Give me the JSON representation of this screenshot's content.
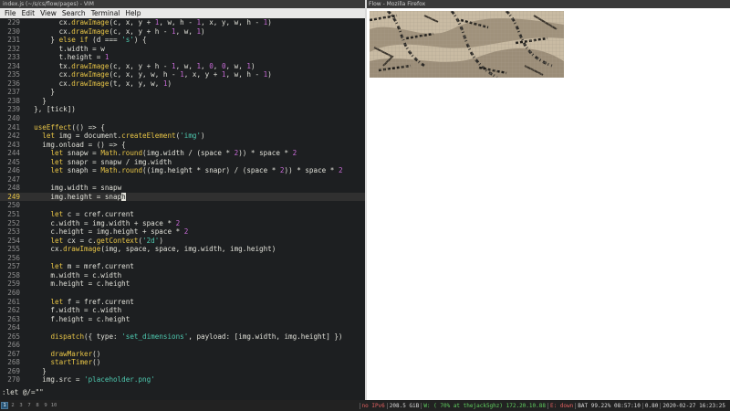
{
  "vim": {
    "window_title": "index.js (~/s/cs/flow/pages) - VIM",
    "menu": [
      "File",
      "Edit",
      "View",
      "Search",
      "Terminal",
      "Help"
    ],
    "command_line": ":let @/=\"\"",
    "current_line": 249,
    "lines": [
      {
        "n": "229",
        "t": "        cx.drawImage(c, x, y + 1, w, h - 1, x, y, w, h - 1)"
      },
      {
        "n": "230",
        "t": "        cx.drawImage(c, x, y + h - 1, w, 1)"
      },
      {
        "n": "231",
        "t": "      } else if (d === 's') {"
      },
      {
        "n": "232",
        "t": "        t.width = w"
      },
      {
        "n": "233",
        "t": "        t.height = 1"
      },
      {
        "n": "234",
        "t": "        tx.drawImage(c, x, y + h - 1, w, 1, 0, 0, w, 1)"
      },
      {
        "n": "235",
        "t": "        cx.drawImage(c, x, y, w, h - 1, x, y + 1, w, h - 1)"
      },
      {
        "n": "236",
        "t": "        cx.drawImage(t, x, y, w, 1)"
      },
      {
        "n": "237",
        "t": "      }"
      },
      {
        "n": "238",
        "t": "    }"
      },
      {
        "n": "239",
        "t": "  }, [tick])"
      },
      {
        "n": "240",
        "t": ""
      },
      {
        "n": "241",
        "t": "  useEffect(() => {"
      },
      {
        "n": "242",
        "t": "    let img = document.createElement('img')"
      },
      {
        "n": "243",
        "t": "    img.onload = () => {"
      },
      {
        "n": "244",
        "t": "      let snapw = Math.round(img.width / (space * 2)) * space * 2"
      },
      {
        "n": "245",
        "t": "      let snapr = snapw / img.width"
      },
      {
        "n": "246",
        "t": "      let snaph = Math.round((img.height * snapr) / (space * 2)) * space * 2"
      },
      {
        "n": "247",
        "t": ""
      },
      {
        "n": "248",
        "t": "      img.width = snapw"
      },
      {
        "n": "249",
        "t": "      img.height = snaph"
      },
      {
        "n": "250",
        "t": ""
      },
      {
        "n": "251",
        "t": "      let c = cref.current"
      },
      {
        "n": "252",
        "t": "      c.width = img.width + space * 2"
      },
      {
        "n": "253",
        "t": "      c.height = img.height + space * 2"
      },
      {
        "n": "254",
        "t": "      let cx = c.getContext('2d')"
      },
      {
        "n": "255",
        "t": "      cx.drawImage(img, space, space, img.width, img.height)"
      },
      {
        "n": "256",
        "t": ""
      },
      {
        "n": "257",
        "t": "      let m = mref.current"
      },
      {
        "n": "258",
        "t": "      m.width = c.width"
      },
      {
        "n": "259",
        "t": "      m.height = c.height"
      },
      {
        "n": "260",
        "t": ""
      },
      {
        "n": "261",
        "t": "      let f = fref.current"
      },
      {
        "n": "262",
        "t": "      f.width = c.width"
      },
      {
        "n": "263",
        "t": "      f.height = c.height"
      },
      {
        "n": "264",
        "t": ""
      },
      {
        "n": "265",
        "t": "      dispatch({ type: 'set_dimensions', payload: [img.width, img.height] })"
      },
      {
        "n": "266",
        "t": ""
      },
      {
        "n": "267",
        "t": "      drawMarker()"
      },
      {
        "n": "268",
        "t": "      startTimer()"
      },
      {
        "n": "269",
        "t": "    }"
      },
      {
        "n": "270",
        "t": "    img.src = 'placeholder.png'"
      }
    ]
  },
  "firefox": {
    "window_title": "Flow - Mozilla Firefox"
  },
  "statusbar": {
    "workspaces": [
      "1",
      "2",
      "3",
      "7",
      "8",
      "9",
      "10"
    ],
    "active_workspace": "1",
    "items": [
      {
        "text": "no IPv6",
        "color": "#e06060"
      },
      {
        "text": "208.5 GiB",
        "color": "#dddddd"
      },
      {
        "text": "W: ( 70% at thejack5ghz) 172.20.10.88",
        "color": "#60d060"
      },
      {
        "text": "E: down",
        "color": "#e06060"
      },
      {
        "text": "BAT 99.22% 08:57:10",
        "color": "#dddddd"
      },
      {
        "text": "0.80",
        "color": "#dddddd"
      },
      {
        "text": "2020-02-27 16:23:25",
        "color": "#dddddd"
      }
    ]
  },
  "colors": {
    "keyword": "#e8c547",
    "string": "#4ec9b0",
    "number": "#c76ad6",
    "text": "#e0e0d8"
  }
}
